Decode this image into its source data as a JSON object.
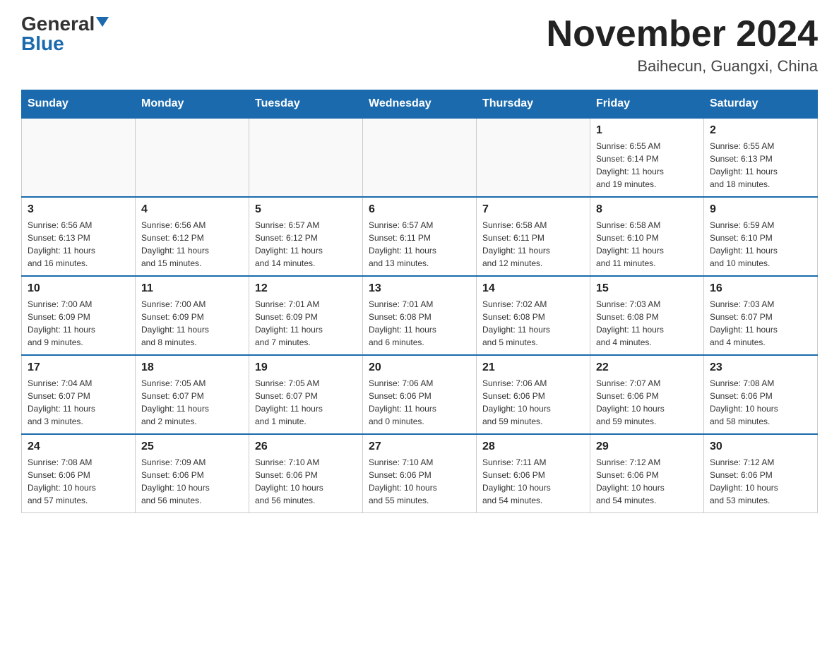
{
  "logo": {
    "general": "General",
    "blue": "Blue"
  },
  "title": "November 2024",
  "subtitle": "Baihecun, Guangxi, China",
  "weekdays": [
    "Sunday",
    "Monday",
    "Tuesday",
    "Wednesday",
    "Thursday",
    "Friday",
    "Saturday"
  ],
  "weeks": [
    [
      {
        "day": "",
        "info": ""
      },
      {
        "day": "",
        "info": ""
      },
      {
        "day": "",
        "info": ""
      },
      {
        "day": "",
        "info": ""
      },
      {
        "day": "",
        "info": ""
      },
      {
        "day": "1",
        "info": "Sunrise: 6:55 AM\nSunset: 6:14 PM\nDaylight: 11 hours\nand 19 minutes."
      },
      {
        "day": "2",
        "info": "Sunrise: 6:55 AM\nSunset: 6:13 PM\nDaylight: 11 hours\nand 18 minutes."
      }
    ],
    [
      {
        "day": "3",
        "info": "Sunrise: 6:56 AM\nSunset: 6:13 PM\nDaylight: 11 hours\nand 16 minutes."
      },
      {
        "day": "4",
        "info": "Sunrise: 6:56 AM\nSunset: 6:12 PM\nDaylight: 11 hours\nand 15 minutes."
      },
      {
        "day": "5",
        "info": "Sunrise: 6:57 AM\nSunset: 6:12 PM\nDaylight: 11 hours\nand 14 minutes."
      },
      {
        "day": "6",
        "info": "Sunrise: 6:57 AM\nSunset: 6:11 PM\nDaylight: 11 hours\nand 13 minutes."
      },
      {
        "day": "7",
        "info": "Sunrise: 6:58 AM\nSunset: 6:11 PM\nDaylight: 11 hours\nand 12 minutes."
      },
      {
        "day": "8",
        "info": "Sunrise: 6:58 AM\nSunset: 6:10 PM\nDaylight: 11 hours\nand 11 minutes."
      },
      {
        "day": "9",
        "info": "Sunrise: 6:59 AM\nSunset: 6:10 PM\nDaylight: 11 hours\nand 10 minutes."
      }
    ],
    [
      {
        "day": "10",
        "info": "Sunrise: 7:00 AM\nSunset: 6:09 PM\nDaylight: 11 hours\nand 9 minutes."
      },
      {
        "day": "11",
        "info": "Sunrise: 7:00 AM\nSunset: 6:09 PM\nDaylight: 11 hours\nand 8 minutes."
      },
      {
        "day": "12",
        "info": "Sunrise: 7:01 AM\nSunset: 6:09 PM\nDaylight: 11 hours\nand 7 minutes."
      },
      {
        "day": "13",
        "info": "Sunrise: 7:01 AM\nSunset: 6:08 PM\nDaylight: 11 hours\nand 6 minutes."
      },
      {
        "day": "14",
        "info": "Sunrise: 7:02 AM\nSunset: 6:08 PM\nDaylight: 11 hours\nand 5 minutes."
      },
      {
        "day": "15",
        "info": "Sunrise: 7:03 AM\nSunset: 6:08 PM\nDaylight: 11 hours\nand 4 minutes."
      },
      {
        "day": "16",
        "info": "Sunrise: 7:03 AM\nSunset: 6:07 PM\nDaylight: 11 hours\nand 4 minutes."
      }
    ],
    [
      {
        "day": "17",
        "info": "Sunrise: 7:04 AM\nSunset: 6:07 PM\nDaylight: 11 hours\nand 3 minutes."
      },
      {
        "day": "18",
        "info": "Sunrise: 7:05 AM\nSunset: 6:07 PM\nDaylight: 11 hours\nand 2 minutes."
      },
      {
        "day": "19",
        "info": "Sunrise: 7:05 AM\nSunset: 6:07 PM\nDaylight: 11 hours\nand 1 minute."
      },
      {
        "day": "20",
        "info": "Sunrise: 7:06 AM\nSunset: 6:06 PM\nDaylight: 11 hours\nand 0 minutes."
      },
      {
        "day": "21",
        "info": "Sunrise: 7:06 AM\nSunset: 6:06 PM\nDaylight: 10 hours\nand 59 minutes."
      },
      {
        "day": "22",
        "info": "Sunrise: 7:07 AM\nSunset: 6:06 PM\nDaylight: 10 hours\nand 59 minutes."
      },
      {
        "day": "23",
        "info": "Sunrise: 7:08 AM\nSunset: 6:06 PM\nDaylight: 10 hours\nand 58 minutes."
      }
    ],
    [
      {
        "day": "24",
        "info": "Sunrise: 7:08 AM\nSunset: 6:06 PM\nDaylight: 10 hours\nand 57 minutes."
      },
      {
        "day": "25",
        "info": "Sunrise: 7:09 AM\nSunset: 6:06 PM\nDaylight: 10 hours\nand 56 minutes."
      },
      {
        "day": "26",
        "info": "Sunrise: 7:10 AM\nSunset: 6:06 PM\nDaylight: 10 hours\nand 56 minutes."
      },
      {
        "day": "27",
        "info": "Sunrise: 7:10 AM\nSunset: 6:06 PM\nDaylight: 10 hours\nand 55 minutes."
      },
      {
        "day": "28",
        "info": "Sunrise: 7:11 AM\nSunset: 6:06 PM\nDaylight: 10 hours\nand 54 minutes."
      },
      {
        "day": "29",
        "info": "Sunrise: 7:12 AM\nSunset: 6:06 PM\nDaylight: 10 hours\nand 54 minutes."
      },
      {
        "day": "30",
        "info": "Sunrise: 7:12 AM\nSunset: 6:06 PM\nDaylight: 10 hours\nand 53 minutes."
      }
    ]
  ]
}
